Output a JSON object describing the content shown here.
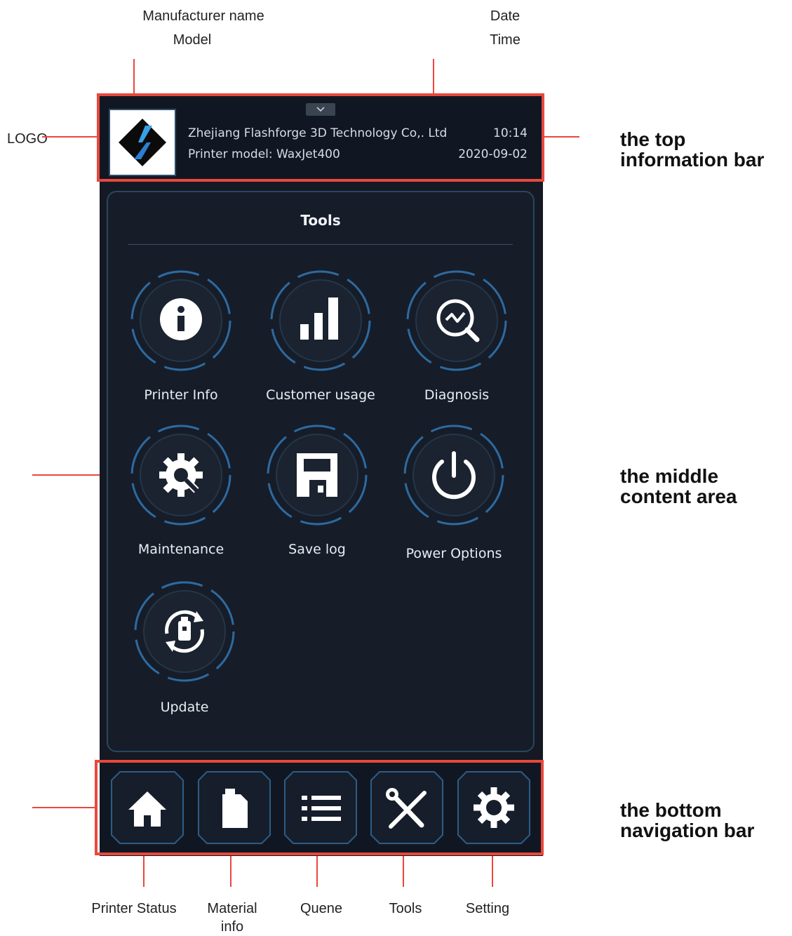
{
  "annotations": {
    "manufacturer": "Manufacturer name",
    "model": "Model",
    "date": "Date",
    "time": "Time",
    "logo": "LOGO",
    "top_bar": "the top information bar",
    "middle_area": "the middle content area",
    "bottom_bar": "the bottom navigation bar",
    "nav_labels": [
      "Printer Status",
      "Material info",
      "Quene",
      "Tools",
      "Setting"
    ]
  },
  "header": {
    "company": "Zhejiang Flashforge 3D Technology Co,. Ltd",
    "model_line": "Printer model:  WaxJet400",
    "time": "10:14",
    "date": "2020-09-02"
  },
  "panel": {
    "title": "Tools",
    "items": [
      {
        "label": "Printer Info",
        "icon": "info-icon"
      },
      {
        "label": "Customer usage",
        "icon": "bar-chart-icon"
      },
      {
        "label": "Diagnosis",
        "icon": "diagnosis-icon"
      },
      {
        "label": "Maintenance",
        "icon": "maintenance-gear-icon"
      },
      {
        "label": "Save log",
        "icon": "save-icon"
      },
      {
        "label": "Power Options",
        "icon": "power-icon"
      },
      {
        "label": "Update",
        "icon": "update-usb-icon"
      }
    ]
  },
  "nav": {
    "icons": [
      "home-icon",
      "material-bottle-icon",
      "list-icon",
      "tools-icon",
      "settings-gear-icon"
    ]
  },
  "colors": {
    "annotation_red": "#e8483d",
    "screen_bg": "#141923",
    "ring_blue": "#2d6aa0"
  }
}
